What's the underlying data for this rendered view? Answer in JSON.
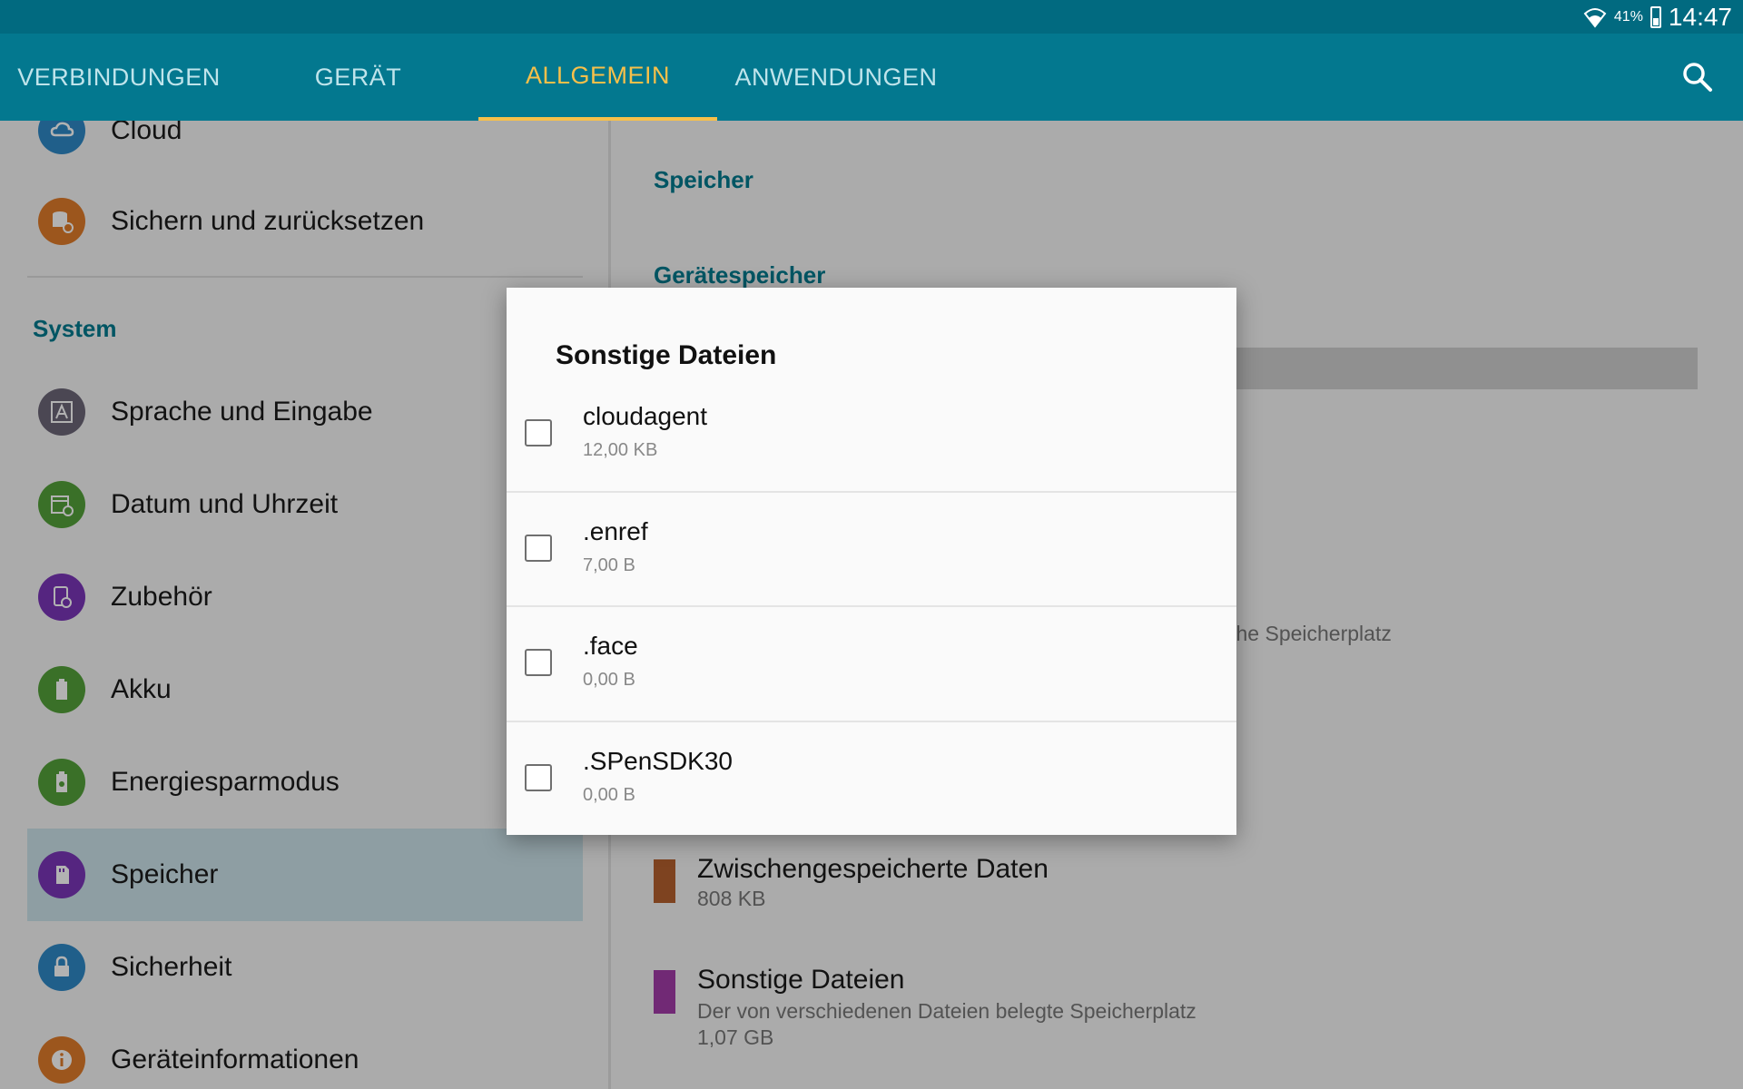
{
  "status_bar": {
    "battery_percent": "41%",
    "time": "14:47",
    "wifi_icon": "wifi-icon",
    "battery_icon": "battery-icon"
  },
  "tabs": [
    {
      "label": "VERBINDUNGEN",
      "active": false
    },
    {
      "label": "GERÄT",
      "active": false
    },
    {
      "label": "ALLGEMEIN",
      "active": true
    },
    {
      "label": "ANWENDUNGEN",
      "active": false
    }
  ],
  "search_icon": "search-icon",
  "sidebar": {
    "top_items": [
      {
        "label": "Cloud",
        "icon": "cloud-sync-icon",
        "color": "#2f88c6"
      },
      {
        "label": "Sichern und zurücksetzen",
        "icon": "backup-icon",
        "color": "#e07c2a"
      }
    ],
    "system_title": "System",
    "system_items": [
      {
        "label": "Sprache und Eingabe",
        "icon": "language-icon",
        "color": "#6c6678"
      },
      {
        "label": "Datum und Uhrzeit",
        "icon": "calendar-clock-icon",
        "color": "#54a13a"
      },
      {
        "label": "Zubehör",
        "icon": "accessory-icon",
        "color": "#7a35b8"
      },
      {
        "label": "Akku",
        "icon": "battery-icon",
        "color": "#54a13a"
      },
      {
        "label": "Energiesparmodus",
        "icon": "power-saving-icon",
        "color": "#54a13a"
      },
      {
        "label": "Speicher",
        "icon": "sd-card-icon",
        "color": "#7a35b8",
        "selected": true
      },
      {
        "label": "Sicherheit",
        "icon": "lock-icon",
        "color": "#2f88c6"
      },
      {
        "label": "Geräteinformationen",
        "icon": "info-icon",
        "color": "#e07c2a"
      }
    ]
  },
  "main": {
    "title": "Speicher",
    "device_storage_title": "Gerätespeicher",
    "partial_text": "che Speicherplatz",
    "legend": [
      {
        "title": "Zwischengespeicherte Daten",
        "desc": "",
        "size": "808 KB",
        "color": "#b5602e"
      },
      {
        "title": "Sonstige Dateien",
        "desc": "Der von verschiedenen Dateien belegte Speicherplatz",
        "size": "1,07 GB",
        "color": "#a23ba8"
      }
    ]
  },
  "dialog": {
    "title": "Sonstige Dateien",
    "files": [
      {
        "name": "cloudagent",
        "size": "12,00 KB",
        "checked": false
      },
      {
        "name": ".enref",
        "size": "7,00 B",
        "checked": false
      },
      {
        "name": ".face",
        "size": "0,00 B",
        "checked": false
      },
      {
        "name": ".SPenSDK30",
        "size": "0,00 B",
        "checked": false
      }
    ]
  }
}
